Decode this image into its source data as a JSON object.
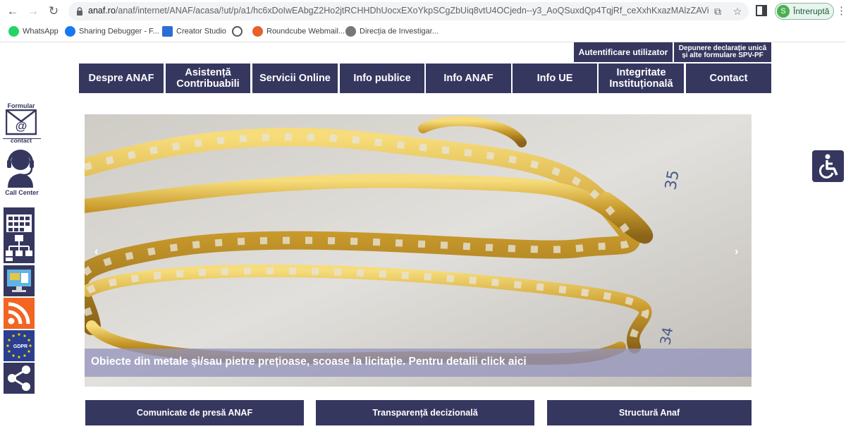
{
  "browser": {
    "url_domain": "anaf.ro",
    "url_path": "/anaf/internet/ANAF/acasa/!ut/p/a1/hc6xDoIwEAbgZ2Ho2jtRCHHDhUocxEXoYkpSCgZbUiq8vtU4OCjedn--y3_AoQSuxdQp4TqjRf_ceXxhKxazMAlzZAViE...",
    "profile_initial": "S",
    "profile_label": "Întreruptă",
    "icons": {
      "back": "back-arrow-icon",
      "forward": "forward-arrow-icon",
      "reload": "reload-icon",
      "share": "share-icon",
      "star": "star-icon",
      "menu": "kebab-menu-icon"
    }
  },
  "bookmarks": [
    {
      "label": "WhatsApp",
      "icon": "whatsapp-icon",
      "color": "#25d366"
    },
    {
      "label": "Sharing Debugger - F...",
      "icon": "facebook-icon",
      "color": "#1877f2"
    },
    {
      "label": "Creator Studio",
      "icon": "creator-studio-icon",
      "color": "#2c6ed5"
    },
    {
      "label": "",
      "icon": "globe-icon",
      "color": "#555555"
    },
    {
      "label": "Roundcube Webmail...",
      "icon": "roundcube-icon",
      "color": "#e8602c"
    },
    {
      "label": "Direcția de Investigar...",
      "icon": "police-badge-icon",
      "color": "#555555"
    }
  ],
  "header": {
    "auth_label": "Autentificare utilizator",
    "spv_line1": "Depunere declarație unică",
    "spv_line2": "și alte formulare SPV-PF"
  },
  "nav": [
    {
      "label": "Despre ANAF"
    },
    {
      "label": "Asistență Contribuabili"
    },
    {
      "label": "Servicii Online"
    },
    {
      "label": "Info publice"
    },
    {
      "label": "Info ANAF"
    },
    {
      "label": "Info UE"
    },
    {
      "label": "Integritate Instituțională"
    },
    {
      "label": "Contact"
    }
  ],
  "sidebar": {
    "form_top": "Formular",
    "form_bottom": "contact",
    "call_center": "Call Center",
    "tiles": [
      {
        "icon": "calendar-grid-icon"
      },
      {
        "icon": "sitemap-icon"
      },
      {
        "icon": "computer-monitor-icon"
      },
      {
        "icon": "rss-icon",
        "color": "#f26522"
      },
      {
        "icon": "gdpr-icon",
        "label": "GDPR"
      },
      {
        "icon": "share-network-icon"
      }
    ]
  },
  "carousel": {
    "caption": "Obiecte din metale și/sau pietre prețioase, scoase la licitație. Pentru detalii click aici",
    "prev": "‹",
    "next": "›",
    "photo_numbers": [
      "35",
      "34"
    ]
  },
  "bottom_links": [
    {
      "label": "Comunicate de presă ANAF"
    },
    {
      "label": "Transparență decizională"
    },
    {
      "label": "Structură Anaf"
    }
  ],
  "colors": {
    "brand": "#36375f",
    "caption_bg": "#9696be"
  }
}
